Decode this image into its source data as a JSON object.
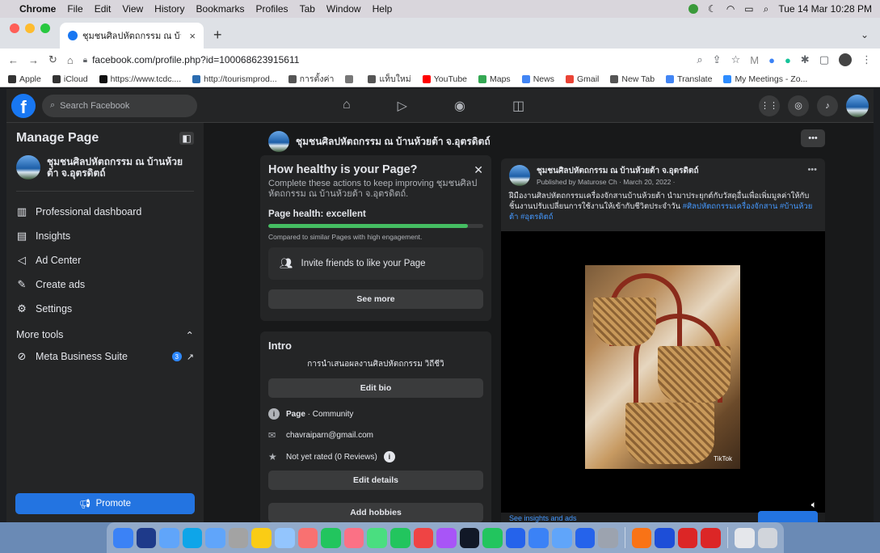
{
  "menubar": {
    "items": [
      "Chrome",
      "File",
      "Edit",
      "View",
      "History",
      "Bookmarks",
      "Profiles",
      "Tab",
      "Window",
      "Help"
    ],
    "datetime": "Tue 14 Mar  10:28 PM"
  },
  "tab": {
    "title": "ชุมชนศิลปหัตถกรรม ณ บ้านห้วยต้",
    "close": "×",
    "new_tab": "+"
  },
  "address": {
    "url": "facebook.com/profile.php?id=100068623915611"
  },
  "bookmarks": [
    {
      "label": "Apple",
      "color": "#333333"
    },
    {
      "label": "iCloud",
      "color": "#333333"
    },
    {
      "label": "https://www.tcdc....",
      "color": "#111111"
    },
    {
      "label": "http://tourismprod...",
      "color": "#2b6cb0"
    },
    {
      "label": "การตั้งค่า",
      "color": "#555555"
    },
    {
      "label": "",
      "color": "#777777"
    },
    {
      "label": "แท็บใหม่",
      "color": "#555555"
    },
    {
      "label": "YouTube",
      "color": "#ff0000"
    },
    {
      "label": "Maps",
      "color": "#34a853"
    },
    {
      "label": "News",
      "color": "#4285f4"
    },
    {
      "label": "Gmail",
      "color": "#ea4335"
    },
    {
      "label": "New Tab",
      "color": "#555555"
    },
    {
      "label": "Translate",
      "color": "#4285f4"
    },
    {
      "label": "My Meetings - Zo...",
      "color": "#2d8cff"
    }
  ],
  "fb": {
    "logo": "f",
    "search_placeholder": "Search Facebook"
  },
  "sidebar": {
    "title": "Manage Page",
    "page_name": "ชุมชนศิลปหัตถกรรม ณ บ้านห้วยต้า จ.อุตรดิตถ์",
    "items": [
      {
        "label": "Professional dashboard",
        "icon": "dashboard-icon",
        "glyph": "▥"
      },
      {
        "label": "Insights",
        "icon": "insights-icon",
        "glyph": "▤"
      },
      {
        "label": "Ad Center",
        "icon": "megaphone-icon",
        "glyph": "◁"
      },
      {
        "label": "Create ads",
        "icon": "pencil-icon",
        "glyph": "✎"
      },
      {
        "label": "Settings",
        "icon": "gear-icon",
        "glyph": "⚙"
      }
    ],
    "more_tools": "More tools",
    "tool": {
      "label": "Meta Business Suite",
      "badge": "3"
    },
    "promote": "Promote"
  },
  "main": {
    "page_header": "ชุมชนศิลปหัตถกรรม ณ บ้านห้วยต้า จ.อุตรดิตถ์",
    "more": "•••",
    "health": {
      "title": "How healthy is your Page?",
      "subtitle": "Complete these actions to keep improving ชุมชนศิลปหัตถกรรม ณ บ้านห้วยต้า จ.อุตรดิตถ์.",
      "status": "Page health: excellent",
      "progress": 0.93,
      "compare": "Compared to similar Pages with high engagement.",
      "invite": "Invite friends to like your Page",
      "see_more": "See more",
      "close": "✕"
    },
    "intro": {
      "title": "Intro",
      "bio": "การนำเสนอผลงานศิลปหัตถกรรม วิถีชีวิ",
      "edit_bio": "Edit bio",
      "category_label": "Page",
      "category_value": " · Community",
      "email": "chavraiparn@gmail.com",
      "rating": "Not yet rated (0 Reviews)",
      "edit_details": "Edit details",
      "add_hobbies": "Add hobbies"
    },
    "post": {
      "author": "ชุมชนศิลปหัตถกรรม ณ บ้านห้วยต้า จ.อุตรดิตถ์",
      "meta": "Published by Maturose Ch  ·  March 20, 2022 ·",
      "more": "•••",
      "text": "ฝีมืองานศิลปหัตถกรรมเครื่องจักสานบ้านห้วยต้า นำมาประยุกต์กับวัสดุอื่นเพื่อเพิ่มมูลค่าให้กับชิ้นงานปรับเปลี่ยนการใช้งานให้เข้ากับชีวิตประจำวัน ",
      "tags": "#ศิลปหัตถกรรมเครื่องจักสาน #บ้านห้วยต้า #อุตรดิตถ์",
      "tiktok": "TikTok",
      "see_insights": "See insights and ads"
    }
  },
  "dock": {
    "colors": [
      "#3b82f6",
      "#1e3a8a",
      "#60a5fa",
      "#0ea5e9",
      "#60a5fa",
      "#a3a3a3",
      "#facc15",
      "#93c5fd",
      "#f87171",
      "#22c55e",
      "#fb7185",
      "#4ade80",
      "#22c55e",
      "#ef4444",
      "#a855f7",
      "#111827",
      "#22c55e",
      "#2563eb",
      "#3b82f6",
      "#60a5fa",
      "#2563eb",
      "#9ca3af",
      "#f97316",
      "#1d4ed8",
      "#dc2626",
      "#dc2626",
      "#e5e7eb",
      "#d1d5db"
    ]
  }
}
